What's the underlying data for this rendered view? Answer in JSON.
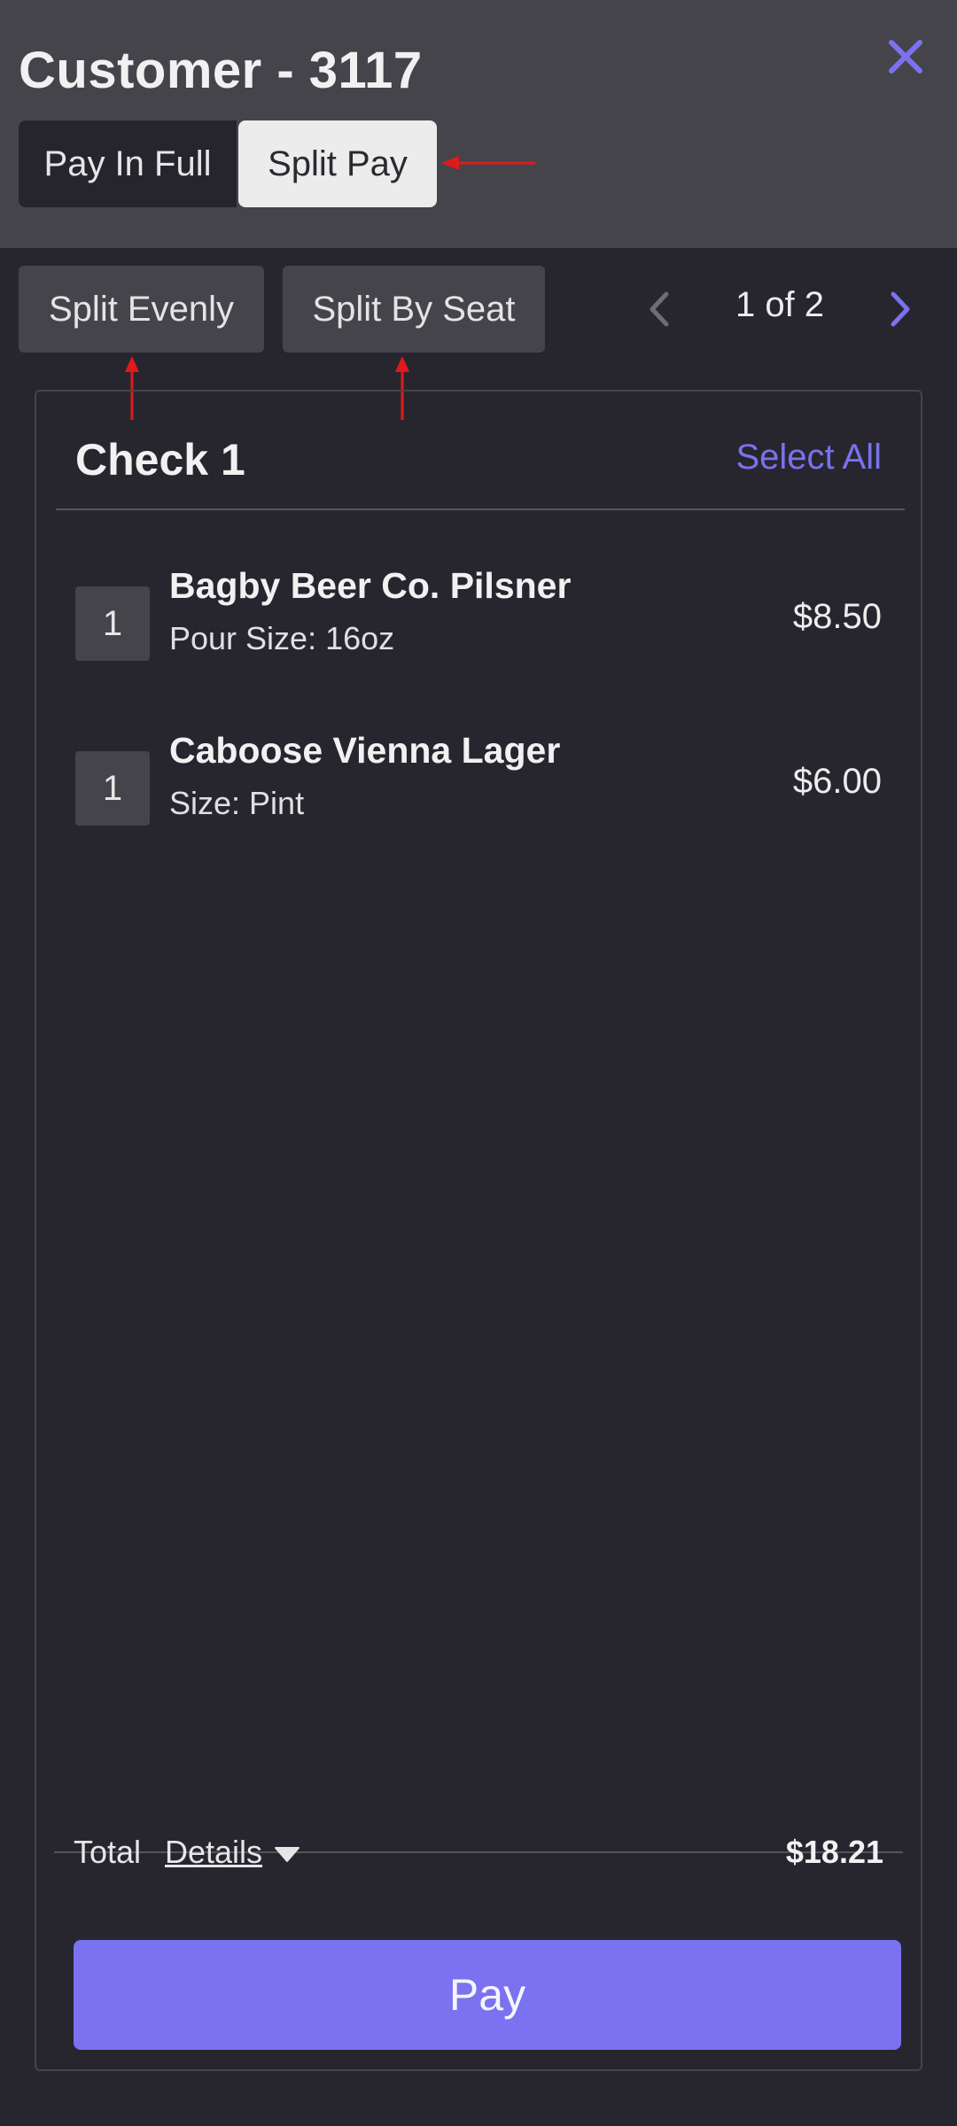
{
  "header": {
    "title": "Customer - 3117",
    "tabs": [
      {
        "label": "Pay In Full",
        "selected": false
      },
      {
        "label": "Split Pay",
        "selected": true
      }
    ],
    "close_icon": "close-icon"
  },
  "toolbar": {
    "split_evenly_label": "Split Evenly",
    "split_by_seat_label": "Split By Seat",
    "pager_label": "1 of 2"
  },
  "check": {
    "title": "Check 1",
    "select_all_label": "Select All",
    "items": [
      {
        "qty": "1",
        "name": "Bagby Beer Co. Pilsner",
        "modifier": "Pour Size: 16oz",
        "price": "$8.50"
      },
      {
        "qty": "1",
        "name": "Caboose Vienna Lager",
        "modifier": "Size: Pint",
        "price": "$6.00"
      }
    ]
  },
  "footer": {
    "total_label": "Total",
    "details_label": "Details",
    "total_amount": "$18.21",
    "pay_label": "Pay"
  },
  "colors": {
    "accent": "#7a72f0",
    "header_bg": "#45444b",
    "page_bg": "#27262f",
    "annotation": "#e01a1a"
  }
}
